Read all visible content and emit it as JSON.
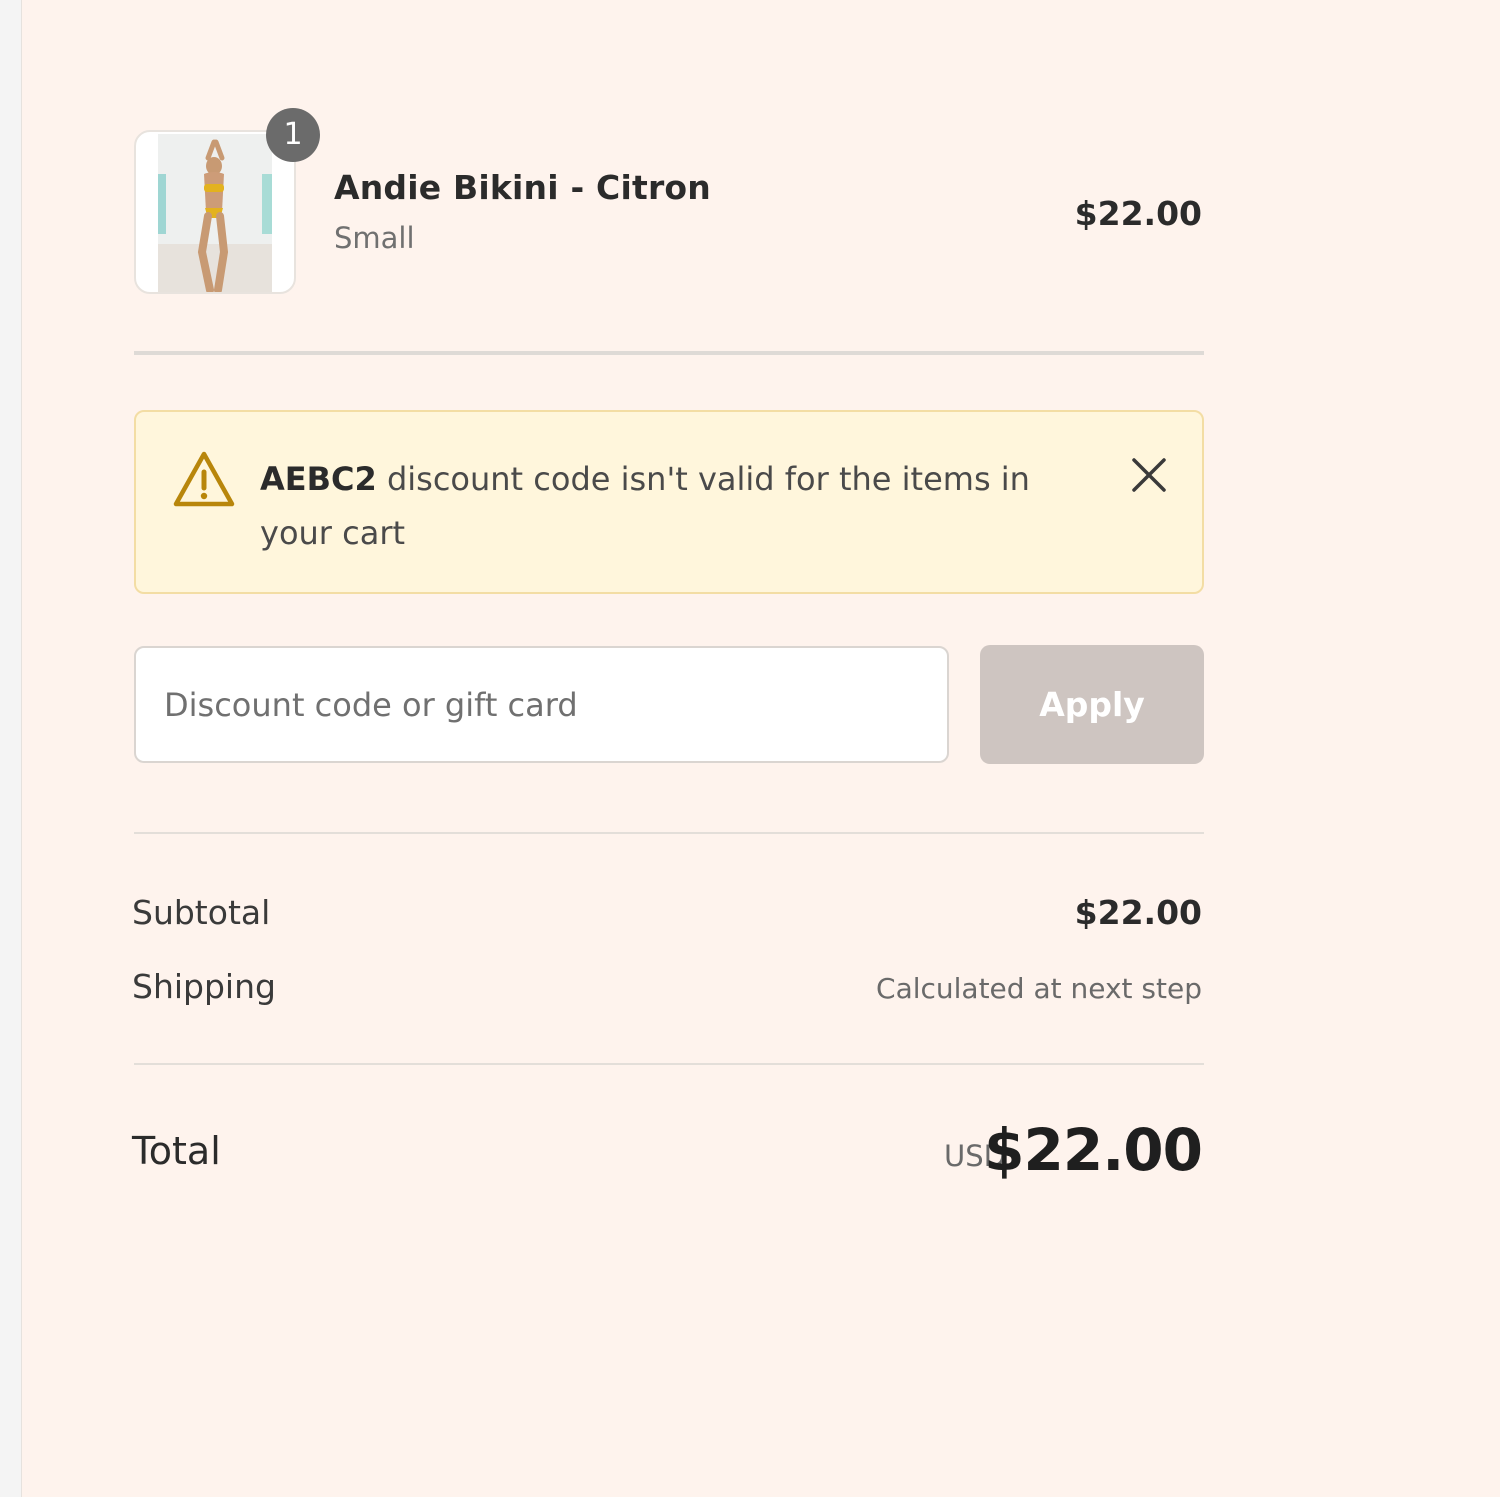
{
  "line_item": {
    "quantity": "1",
    "name": "Andie Bikini - Citron",
    "variant": "Small",
    "price": "$22.00"
  },
  "alert": {
    "code": "AEBC2",
    "message": " discount code isn't valid for the items in your cart",
    "icon": "warning-icon",
    "close_icon": "close-icon",
    "accent_color": "#b8860b"
  },
  "discount": {
    "placeholder": "Discount code or gift card",
    "value": "",
    "apply_label": "Apply"
  },
  "totals": {
    "subtotal_label": "Subtotal",
    "subtotal_value": "$22.00",
    "shipping_label": "Shipping",
    "shipping_value": "Calculated at next step",
    "total_label": "Total",
    "currency": "USD",
    "total_value": "$22.00"
  },
  "colors": {
    "page_background": "#fef3ed",
    "apply_disabled": "#cec5c1",
    "alert_background": "#fff6dc"
  }
}
